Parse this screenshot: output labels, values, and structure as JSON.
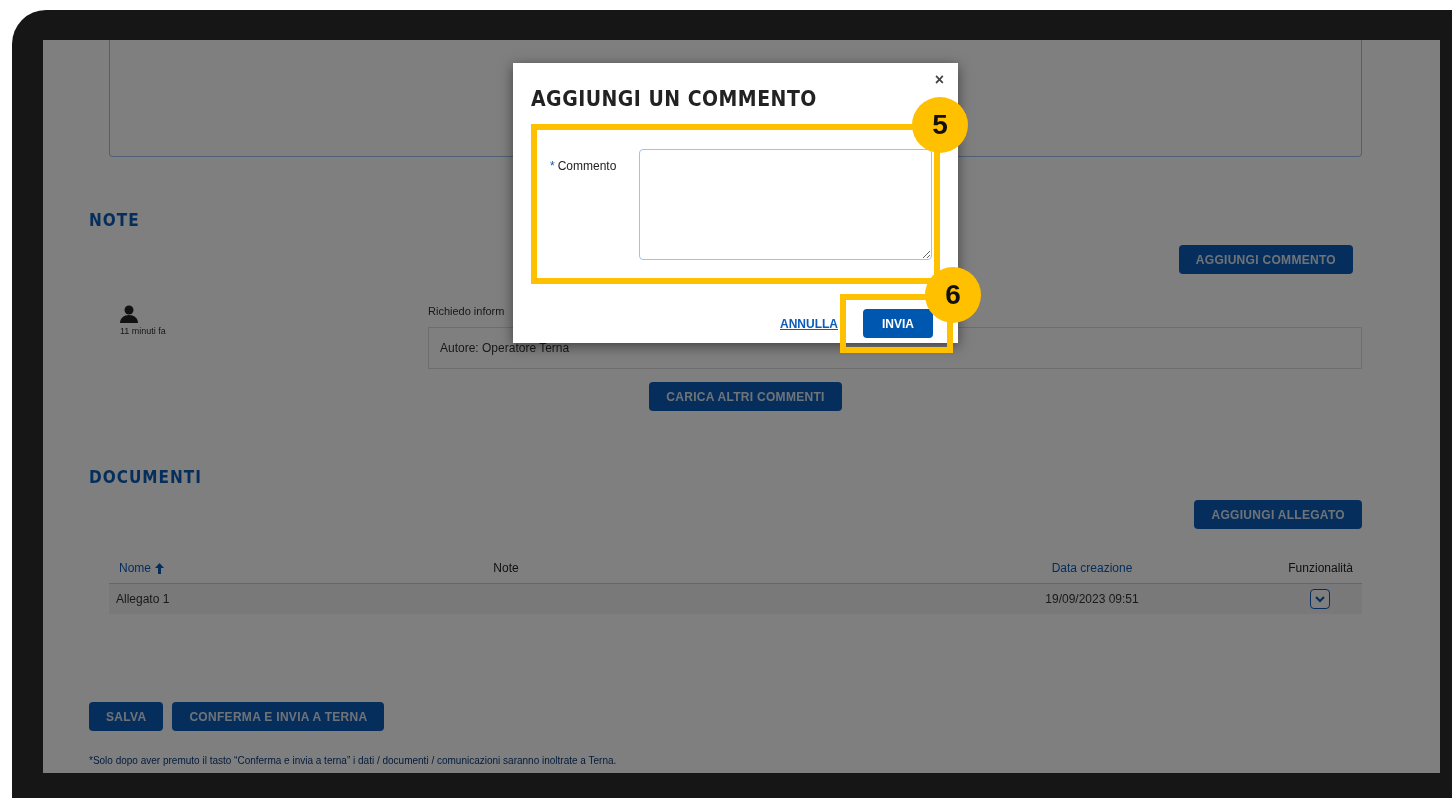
{
  "page": {
    "top_field": {
      "kind": "textarea"
    },
    "notes": {
      "heading": "NOTE",
      "add_button": "AGGIUNGI COMMENTO",
      "comments": [
        {
          "time": "11 minuti fa",
          "text": "Richiedo inform",
          "author": "Autore: Operatore Terna"
        }
      ],
      "load_more_button": "CARICA ALTRI COMMENTI"
    },
    "documents": {
      "heading": "DOCUMENTI",
      "add_button": "AGGIUNGI ALLEGATO",
      "table": {
        "columns": [
          {
            "label": "Nome",
            "sortable": true,
            "sorted": true
          },
          {
            "label": "Note",
            "sortable": false,
            "sorted": false
          },
          {
            "label": "Data creazione",
            "sortable": true,
            "sorted": false
          },
          {
            "label": "Funzionalità",
            "sortable": false,
            "sorted": false
          }
        ],
        "rows": [
          {
            "name": "Allegato 1",
            "date": "19/09/2023 09:51"
          }
        ]
      }
    },
    "buttons": [
      {
        "label": "SALVA"
      },
      {
        "label": "CONFERMA E INVIA A TERNA"
      }
    ],
    "footnote": "*Solo dopo aver premuto il tasto “Conferma e invia a terna” i dati / documenti / comunicazioni saranno inoltrate a Terna."
  },
  "modal": {
    "title": "AGGIUNGI UN COMMENTO",
    "close": "×",
    "field": {
      "label": "Commento",
      "required_mark": "*"
    },
    "cancel": "ANNULLA",
    "submit": "INVIA"
  },
  "callouts": [
    {
      "number": "5"
    },
    {
      "number": "6"
    }
  ]
}
